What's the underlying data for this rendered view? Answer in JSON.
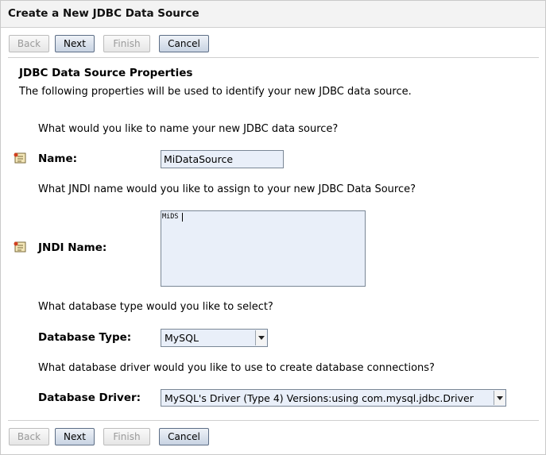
{
  "window": {
    "title": "Create a New JDBC Data Source"
  },
  "buttons": {
    "back": "Back",
    "next": "Next",
    "finish": "Finish",
    "cancel": "Cancel"
  },
  "section": {
    "heading": "JDBC Data Source Properties",
    "description": "The following properties will be used to identify your new JDBC data source."
  },
  "name": {
    "question": "What would you like to name your new JDBC data source?",
    "label": "Name:",
    "value": "MiDataSource"
  },
  "jndi": {
    "question": "What JNDI name would you like to assign to your new JDBC Data Source?",
    "label": "JNDI Name:",
    "value": "MiDS"
  },
  "db_type": {
    "question": "What database type would you like to select?",
    "label": "Database Type:",
    "selected": "MySQL"
  },
  "db_driver": {
    "question": "What database driver would you like to use to create database connections?",
    "label": "Database Driver:",
    "selected": "MySQL's Driver (Type 4) Versions:using com.mysql.jdbc.Driver"
  }
}
